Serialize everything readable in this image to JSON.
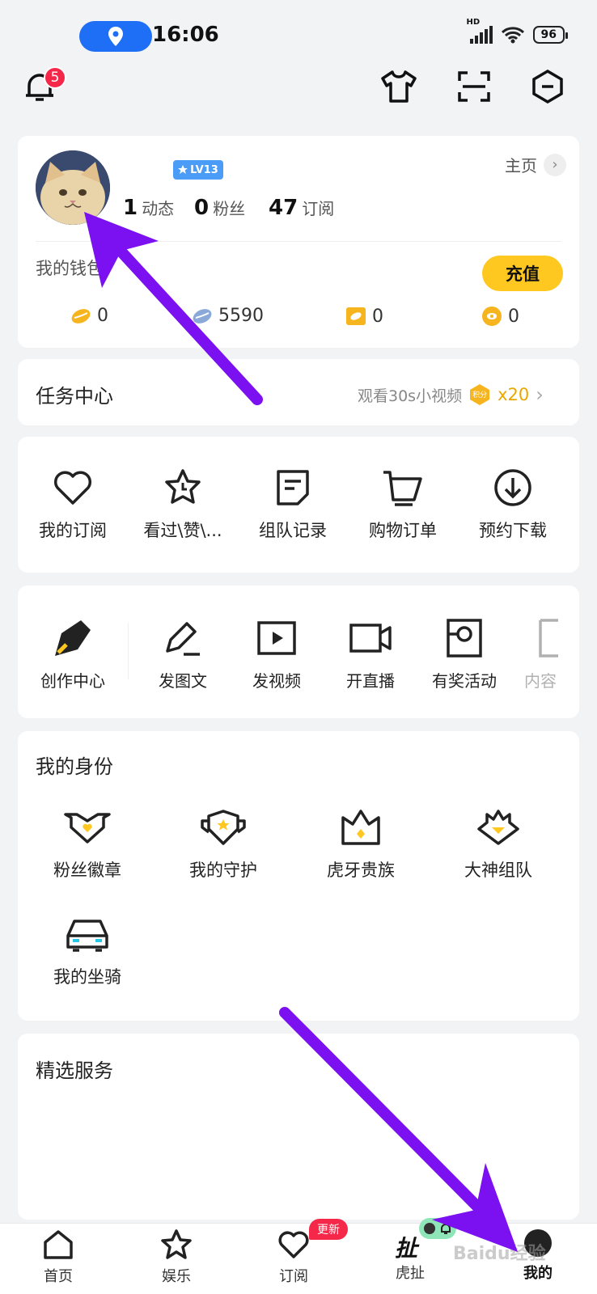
{
  "status_bar": {
    "time": "16:06",
    "battery": "96",
    "signal_label": "HD"
  },
  "top_bar": {
    "notification_count": "5"
  },
  "profile": {
    "level": "LV13",
    "home_link": "主页",
    "stats": [
      {
        "num": "1",
        "label": "动态"
      },
      {
        "num": "0",
        "label": "粉丝"
      },
      {
        "num": "47",
        "label": "订阅"
      }
    ],
    "wallet_label": "我的钱包",
    "recharge_label": "充值",
    "wallet_values": [
      "0",
      "5590",
      "0",
      "0"
    ]
  },
  "tasks": {
    "title": "任务中心",
    "hint": "观看30s小视频",
    "points_tag": "积分",
    "reward": "x20"
  },
  "quick": {
    "items": [
      "我的订阅",
      "看过\\赞\\...",
      "组队记录",
      "购物订单",
      "预约下载"
    ]
  },
  "create": {
    "items": [
      "创作中心",
      "发图文",
      "发视频",
      "开直播",
      "有奖活动",
      "内容"
    ]
  },
  "identity": {
    "title": "我的身份",
    "items": [
      "粉丝徽章",
      "我的守护",
      "虎牙贵族",
      "大神组队",
      "我的坐骑"
    ]
  },
  "services": {
    "title": "精选服务"
  },
  "navbar": {
    "items": [
      "首页",
      "娱乐",
      "订阅",
      "虎扯",
      "我的"
    ],
    "update_badge": "更新",
    "huche_logo": "扯"
  },
  "watermark": "Baidu经验",
  "colors": {
    "accent_yellow": "#ffc820",
    "badge_red": "#f5284a",
    "arrow_purple": "#7b10f0",
    "level_blue": "#4b9cf7"
  }
}
